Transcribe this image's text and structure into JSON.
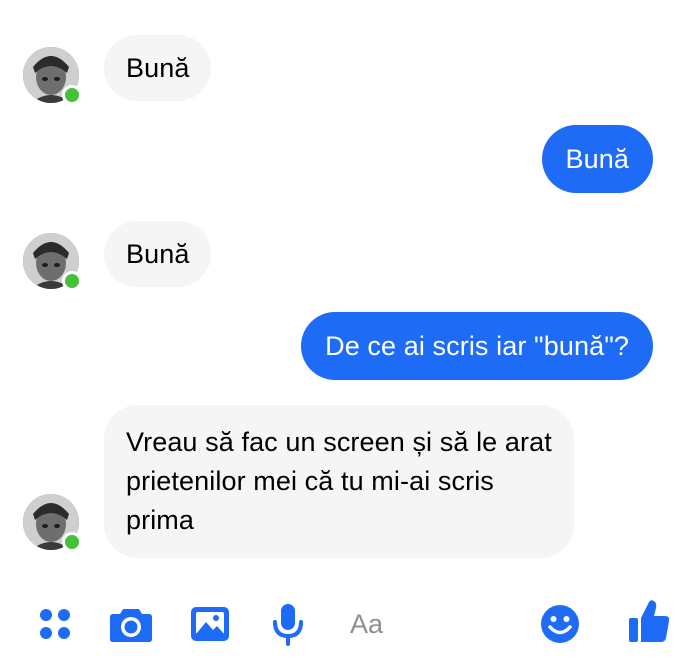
{
  "colors": {
    "accent": "#1e6cf6",
    "incoming_bubble": "#f5f5f5",
    "online": "#44c03a"
  },
  "messages": [
    {
      "direction": "incoming",
      "text": "Bună"
    },
    {
      "direction": "outgoing",
      "text": "Bună"
    },
    {
      "direction": "incoming",
      "text": "Bună"
    },
    {
      "direction": "outgoing",
      "text": "De ce ai scris iar \"bună\"?"
    },
    {
      "direction": "incoming",
      "text": "Vreau să fac un screen și să le arat prietenilor mei că tu mi-ai scris prima"
    }
  ],
  "toolbar": {
    "icons": [
      "menu-dots-icon",
      "camera-icon",
      "gallery-icon",
      "microphone-icon",
      "emoji-icon",
      "thumbs-up-icon"
    ],
    "compose_placeholder": "Aa"
  }
}
